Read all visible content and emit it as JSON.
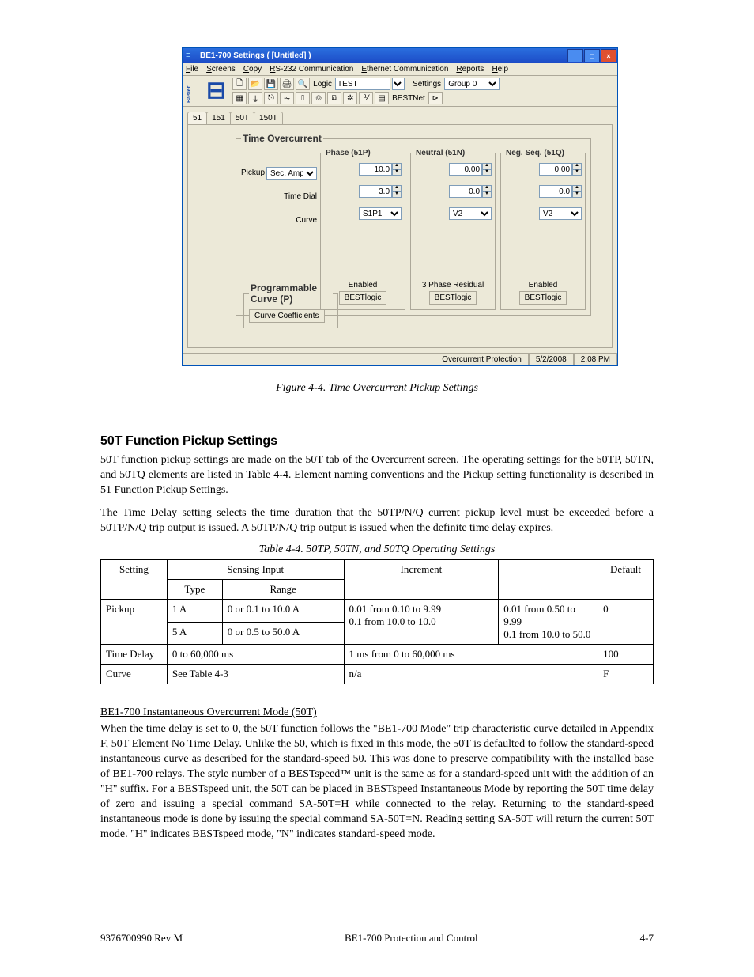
{
  "window": {
    "title": "BE1-700 Settings   ( [Untitled] )",
    "min_icon": "_",
    "max_icon": "□",
    "close_icon": "×"
  },
  "menu": [
    "File",
    "Screens",
    "Copy",
    "RS-232 Communication",
    "Ethernet Communication",
    "Reports",
    "Help"
  ],
  "toolbar": {
    "logic_label": "Logic",
    "logic_value": "TEST",
    "settings_label": "Settings",
    "settings_value": "Group 0",
    "bestnet_label": "BESTNet"
  },
  "tabs": [
    "51",
    "151",
    "50T",
    "150T"
  ],
  "active_tab": "51",
  "panel": {
    "legend": "Time Overcurrent",
    "row_labels": [
      "Pickup",
      "Time Dial",
      "Curve"
    ],
    "pickup_units": "Sec. Amps",
    "phase": {
      "legend": "Phase (51P)",
      "pickup": "10.0",
      "time_dial": "3.0",
      "curve": "S1P1",
      "footer1": "Enabled",
      "footer2": "BESTlogic"
    },
    "neutral": {
      "legend": "Neutral (51N)",
      "pickup": "0.00",
      "time_dial": "0.0",
      "curve": "V2",
      "footer1": "3 Phase Residual",
      "footer2": "BESTlogic"
    },
    "negseq": {
      "legend": "Neg. Seq. (51Q)",
      "pickup": "0.00",
      "time_dial": "0.0",
      "curve": "V2",
      "footer1": "Enabled",
      "footer2": "BESTlogic"
    },
    "prog_curve_legend": "Programmable Curve (P)",
    "prog_curve_btn": "Curve Coefficients"
  },
  "statusbar": {
    "pane1": "Overcurrent Protection",
    "pane2": "5/2/2008",
    "pane3": "2:08 PM"
  },
  "doc": {
    "fig_caption": "Figure 4-4. Time Overcurrent Pickup Settings",
    "h3": "50T Function Pickup Settings",
    "p1": "50T function pickup settings are made on the 50T tab of the Overcurrent screen. The operating settings for the 50TP, 50TN, and 50TQ elements are listed in Table 4-4. Element naming conventions and the Pickup setting functionality is described in 51 Function Pickup Settings.",
    "p2": "The Time Delay setting selects the time duration that the 50TP/N/Q current pickup level must be exceeded before a 50TP/N/Q trip output is issued. A 50TP/N/Q trip output is issued when the definite time delay expires.",
    "tbl_caption": "Table 4-4. 50TP, 50TN, and 50TQ Operating Settings",
    "table": {
      "cols": [
        "Setting",
        "Sensing Input",
        "Range",
        "Increment",
        "Default"
      ],
      "sensing_sub": [
        "Type",
        "Range"
      ],
      "rows": [
        {
          "setting": "Pickup",
          "type": "1 A",
          "range": "0 or 0.1 to 10.0 A",
          "inc": "0.01 from 0.10 to 9.99\n0.1 from 10.0 to 10.0",
          "def": "0"
        },
        {
          "setting": "Pickup",
          "type": "5 A",
          "range": "0 or 0.5 to 50.0 A",
          "inc": "0.01 from 0.50 to 9.99\n0.1 from 10.0 to 50.0",
          "def": "0"
        },
        {
          "setting": "Time Delay",
          "type": "",
          "range": "",
          "inc": "0 to 60,000 ms",
          "def": "1 ms from 0 to 60,000 ms",
          "def2": "100"
        },
        {
          "setting": "Curve",
          "type": "",
          "range": "",
          "inc": "See Table 4-3",
          "def": "n/a",
          "def2": "F"
        }
      ]
    },
    "underline": "BE1-700 Instantaneous Overcurrent Mode (50T)",
    "p3": "When the time delay is set to 0, the 50T function follows the \"BE1-700 Mode\" trip characteristic curve detailed in Appendix F, 50T Element No Time Delay. Unlike the 50, which is fixed in this mode, the 50T is defaulted to follow the standard-speed instantaneous curve as described for the standard-speed 50. This was done to preserve compatibility with the installed base of BE1-700 relays. The style number of a BESTspeed™ unit is the same as for a standard-speed unit with the addition of an \"H\" suffix. For a BESTspeed unit, the 50T can be placed in BESTspeed Instantaneous Mode by reporting the 50T time delay of zero and issuing a special command SA-50T=H while connected to the relay. Returning to the standard-speed instantaneous mode is done by issuing the special command SA-50T=N. Reading setting SA-50T will return the current 50T mode. \"H\" indicates BESTspeed mode, \"N\" indicates standard-speed mode.",
    "footer_left": "9376700990 Rev M",
    "footer_center": "BE1-700 Protection and Control",
    "footer_right": "4-7"
  }
}
